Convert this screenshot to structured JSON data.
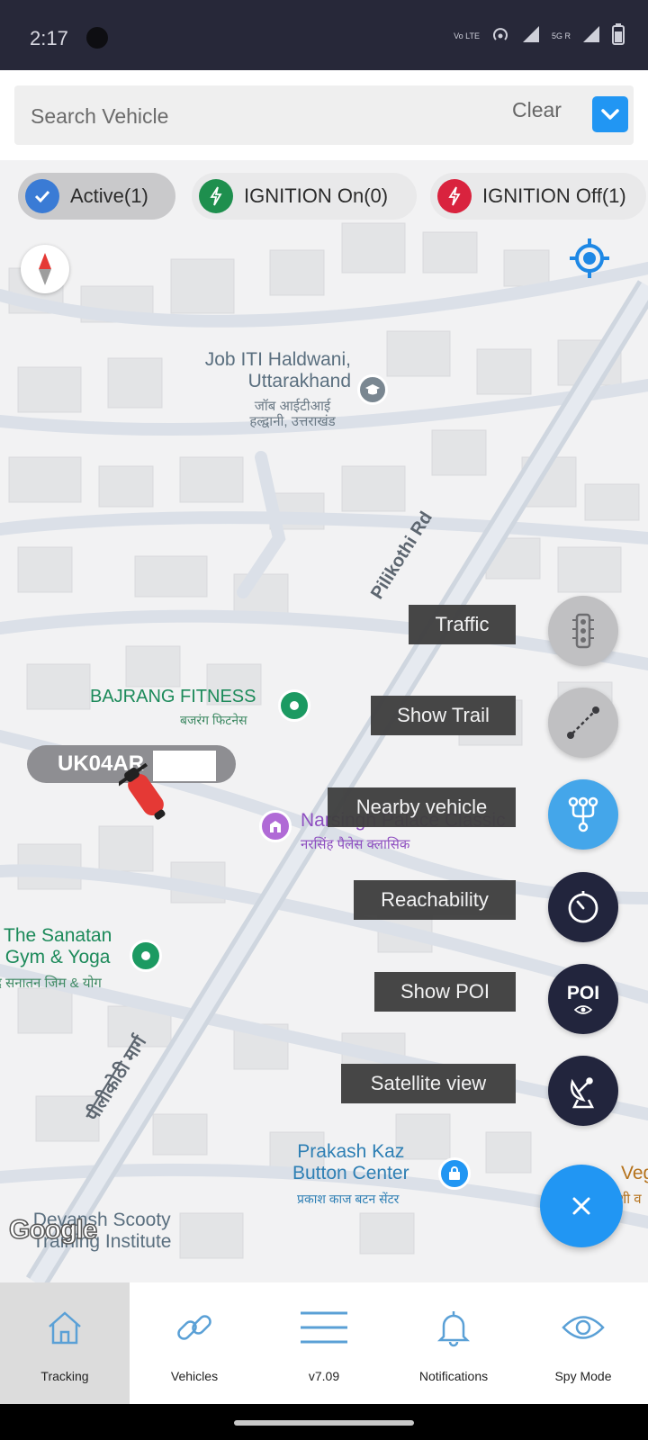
{
  "status_bar": {
    "time": "2:17",
    "network_label": "Vo LTE",
    "signal_label": "5G R"
  },
  "search": {
    "placeholder": "Search Vehicle",
    "clear_label": "Clear"
  },
  "filters": [
    {
      "label": "Active(1)",
      "color": "#3a7bd5"
    },
    {
      "label": "IGNITION On(0)",
      "color": "#1e8f4e"
    },
    {
      "label": "IGNITION Off(1)",
      "color": "#d9233e"
    }
  ],
  "map": {
    "labels": {
      "job_iti_en": "Job ITI Haldwani,\nUttarakhand",
      "job_iti_hi": "जॉब आईटीआई\nहल्द्वानी, उत्तराखंड",
      "road_en": "Pilikothi Rd",
      "road_hi": "पीलीकोठी मार्ग",
      "bajrang_en": "BAJRANG FITNESS",
      "bajrang_hi": "बजरंग फिटनेस",
      "narsingh_en": "Narsingh Palace Classic",
      "narsingh_hi": "नरसिंह पैलेस क्लासिक",
      "sanatan_en": "The Sanatan\nGym & Yoga",
      "sanatan_hi": "द सनातन जिम & योग",
      "prakash_en": "Prakash Kaz\nButton Center",
      "prakash_hi": "प्रकाश काज बटन सेंटर",
      "devansh_en": "Devansh Scooty\nTraining Institute",
      "right_edge_en": "Veg",
      "right_edge_hi": "शी व"
    },
    "google_logo": "Google",
    "vehicle_plate": "UK04AR"
  },
  "actions": [
    {
      "label": "Traffic",
      "icon": "traffic-light-icon"
    },
    {
      "label": "Show Trail",
      "icon": "trail-icon"
    },
    {
      "label": "Nearby vehicle",
      "icon": "nearby-icon"
    },
    {
      "label": "Reachability",
      "icon": "timer-icon"
    },
    {
      "label": "Show POI",
      "icon": "poi-icon",
      "icon_text": "POI"
    },
    {
      "label": "Satellite view",
      "icon": "satellite-icon"
    }
  ],
  "bottom_nav": [
    {
      "label": "Tracking",
      "icon": "home-icon",
      "active": true
    },
    {
      "label": "Vehicles",
      "icon": "link-icon",
      "active": false
    },
    {
      "label": "v7.09",
      "icon": "menu-icon",
      "active": false
    },
    {
      "label": "Notifications",
      "icon": "bell-icon",
      "active": false
    },
    {
      "label": "Spy Mode",
      "icon": "eye-icon",
      "active": false
    }
  ]
}
